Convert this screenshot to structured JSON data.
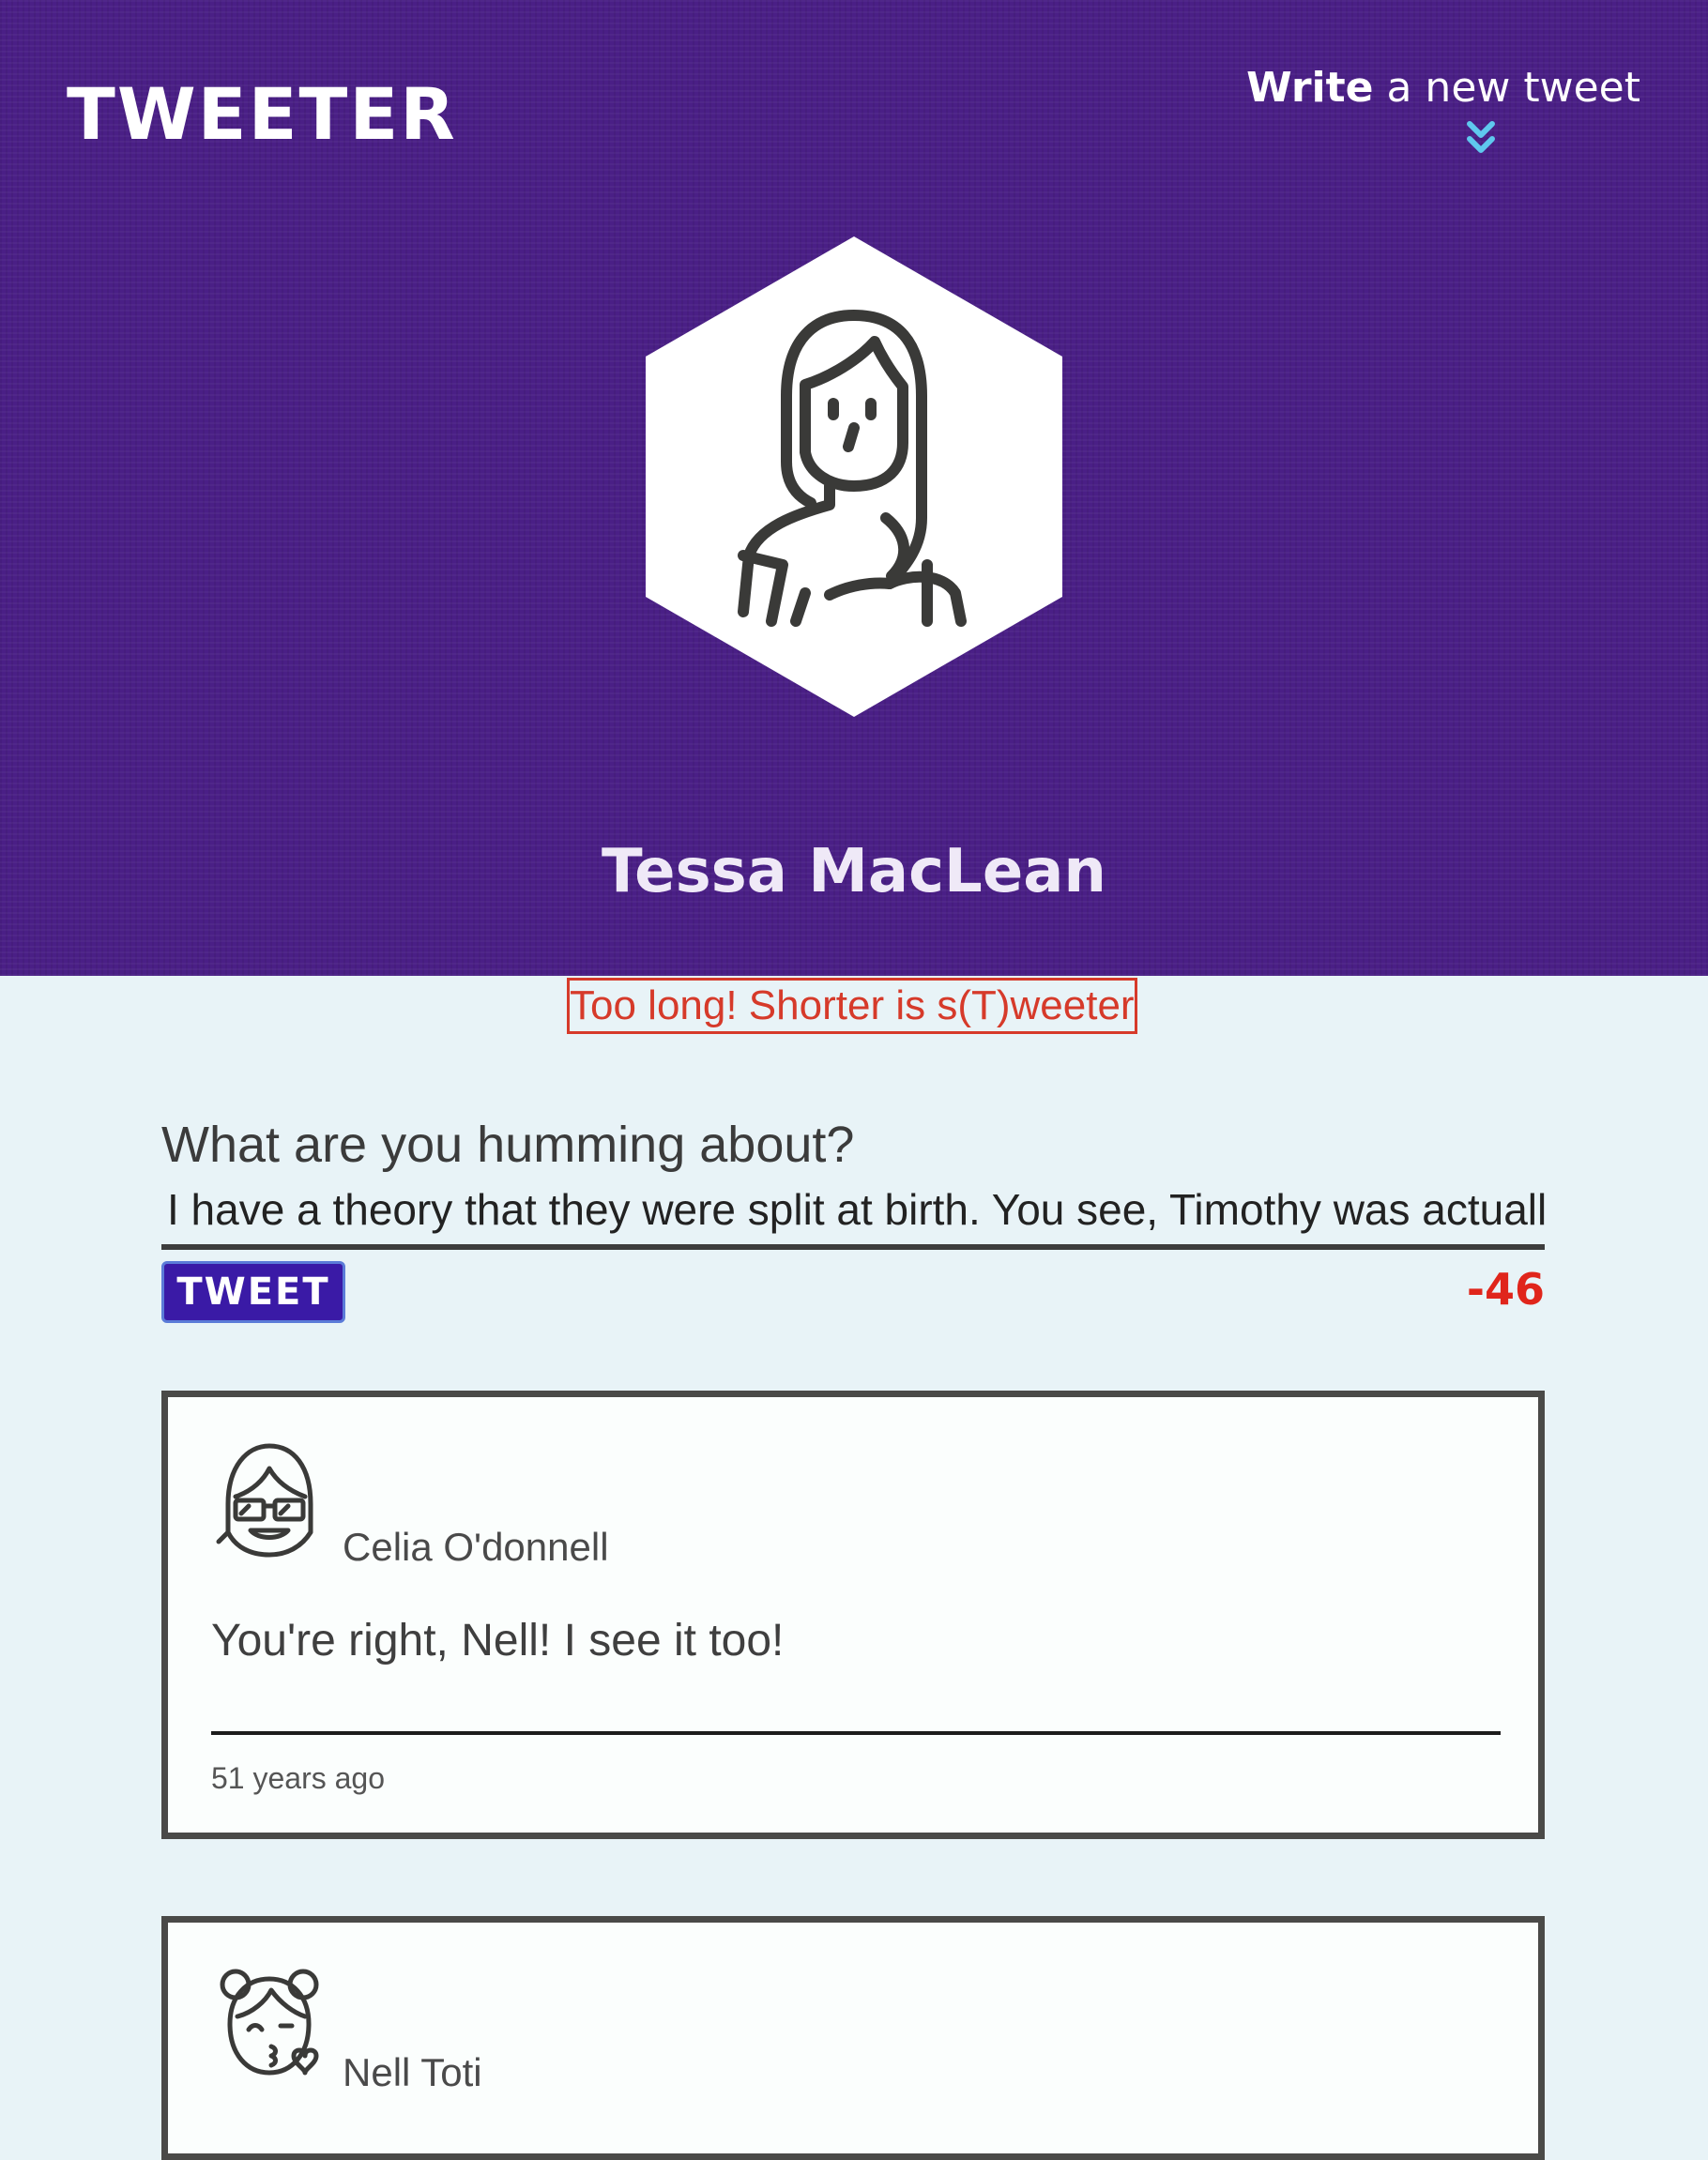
{
  "header": {
    "brand": "TWEETER",
    "compose_toggle_bold": "Write",
    "compose_toggle_rest": " a new tweet",
    "background_color": "#4a1f86",
    "chevron_color": "#5fc8ee"
  },
  "profile": {
    "name": "Tessa MacLean"
  },
  "error": {
    "message": "Too long! Shorter is s(T)weeter!",
    "color": "#d63a2a"
  },
  "composer": {
    "prompt": "What are you humming about?",
    "input_value": "I have a theory that they were split at birth. You see, Timothy was actually",
    "button_label": "TWEET",
    "char_counter": "-46"
  },
  "tweets": [
    {
      "author": "Celia O'donnell",
      "avatar_icon": "girl-with-glasses-icon",
      "text": "You're right, Nell! I see it too!",
      "time": "51 years ago"
    },
    {
      "author": "Nell Toti",
      "avatar_icon": "girl-blowing-kiss-icon",
      "text": "",
      "time": ""
    }
  ]
}
